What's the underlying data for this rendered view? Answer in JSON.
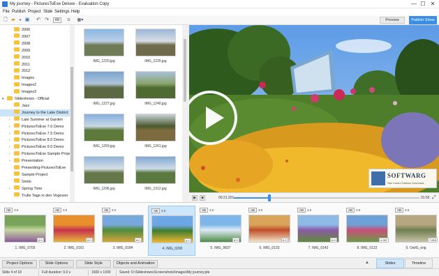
{
  "window": {
    "title": "My journey - PicturesToExe Deluxe - Evaluation Copy",
    "minimize": "—",
    "maximize": "☐",
    "close": "✕"
  },
  "menu": [
    "File",
    "Publish",
    "Project",
    "Slide",
    "Settings",
    "Help"
  ],
  "toolbar": {
    "ab_label": "AB",
    "drive_label": "D:",
    "preview_label": "Preview",
    "publish_label": "Publish Show"
  },
  "tree": {
    "items": [
      {
        "label": "2006",
        "indent": 1
      },
      {
        "label": "2007",
        "indent": 1
      },
      {
        "label": "2008",
        "indent": 1
      },
      {
        "label": "2009",
        "indent": 1
      },
      {
        "label": "2010",
        "indent": 1
      },
      {
        "label": "2011",
        "indent": 1
      },
      {
        "label": "2012",
        "indent": 1
      },
      {
        "label": "Images",
        "indent": 1
      },
      {
        "label": "Images2",
        "indent": 1
      },
      {
        "label": "Images3",
        "indent": 1
      },
      {
        "label": "Slideshows - Official",
        "indent": 0,
        "expanded": true
      },
      {
        "label": "Jazz",
        "indent": 1
      },
      {
        "label": "Journey to the Lake District",
        "indent": 1,
        "selected": true
      },
      {
        "label": "Late Summer at Garden",
        "indent": 1,
        "collapsed": true
      },
      {
        "label": "PicturesToExe 7.0 Demo",
        "indent": 1,
        "collapsed": true
      },
      {
        "label": "PicturesToExe 7.5 Demo",
        "indent": 1,
        "collapsed": true
      },
      {
        "label": "PicturesToExe 8.0 Demo",
        "indent": 1,
        "collapsed": true
      },
      {
        "label": "PicturesToExe 9.0 Demo",
        "indent": 1,
        "collapsed": true
      },
      {
        "label": "PicturesToExe Sample Project",
        "indent": 1,
        "collapsed": true
      },
      {
        "label": "Presentation",
        "indent": 1,
        "collapsed": true
      },
      {
        "label": "Presenting-PicturesToExe",
        "indent": 1
      },
      {
        "label": "Sample Project",
        "indent": 1
      },
      {
        "label": "Smile",
        "indent": 1
      },
      {
        "label": "Spring Time",
        "indent": 1,
        "collapsed": true
      },
      {
        "label": "Trulle Tage in den Vogesen",
        "indent": 1
      }
    ]
  },
  "files": [
    {
      "name": "IMG_1220.jpg",
      "colors": [
        "#8db6e0",
        "#b9cfe6",
        "#6f7b57"
      ]
    },
    {
      "name": "IMG_1225.jpg",
      "colors": [
        "#9ab8d6",
        "#d8dde3",
        "#6f6a4c"
      ]
    },
    {
      "name": "IMG_1227.jpg",
      "colors": [
        "#7aa3cf",
        "#b0c4d8",
        "#5c6841"
      ]
    },
    {
      "name": "IMG_1240.jpg",
      "colors": [
        "#a6c1dc",
        "#8aa36a",
        "#4f6b32"
      ]
    },
    {
      "name": "IMG_1259.jpg",
      "colors": [
        "#86b0dc",
        "#c9d8e6",
        "#5d7a3a"
      ]
    },
    {
      "name": "IMG_1261.jpg",
      "colors": [
        "#c9d2d9",
        "#4c5a30",
        "#7d6a3f"
      ]
    },
    {
      "name": "IMG_1296.jpg",
      "colors": [
        "#8fb4d9",
        "#d7dfe6",
        "#66784a"
      ]
    },
    {
      "name": "IMG_1312.jpg",
      "colors": [
        "#7fa8d2",
        "#cfdbe6",
        "#5c7942"
      ]
    }
  ],
  "player": {
    "time_current": "00:21.201",
    "time_total": "01:56",
    "progress": 0.19,
    "play": "▶",
    "stop": "■",
    "expand": "⤢"
  },
  "watermark": {
    "brand": "SOFTWARG",
    "tagline": "Safe Hosted Software Downloads"
  },
  "slides": [
    {
      "label": "1. IMG_0703",
      "ab": "AB",
      "duration": "3.0",
      "thumb_duration": "6.0",
      "colors": [
        "#79a35b",
        "#c6d7a1",
        "#8a5b9a"
      ]
    },
    {
      "label": "2. IMG_0161",
      "ab": "AB",
      "duration": "3.0",
      "thumb_duration": "6.0",
      "colors": [
        "#e88f2c",
        "#c8324d",
        "#e5b63b"
      ]
    },
    {
      "label": "3. IMG_0184",
      "ab": "AB",
      "duration": "3.0",
      "thumb_duration": "6.0",
      "colors": [
        "#78a9dc",
        "#4f8a3c",
        "#d5a53a"
      ]
    },
    {
      "label": "4. IMG_0200",
      "ab": "AB",
      "duration": "3.0",
      "thumb_duration": "6.0",
      "colors": [
        "#6ea7e6",
        "#3f7c2e",
        "#efb932"
      ],
      "selected": true
    },
    {
      "label": "5. IMG_9607",
      "ab": "AB",
      "duration": "3.0",
      "thumb_duration": "6.0",
      "colors": [
        "#7db7ea",
        "#dfeaf3",
        "#4e8b45"
      ]
    },
    {
      "label": "6. IMG_0133",
      "ab": "AB",
      "duration": "3.0",
      "thumb_duration": "6.0",
      "colors": [
        "#d9a55b",
        "#c14d2a",
        "#f1e3c6"
      ]
    },
    {
      "label": "7. IMG_0142",
      "ab": "AB",
      "duration": "3.0",
      "thumb_duration": "6.0",
      "colors": [
        "#8dbbe6",
        "#8c5aa6",
        "#5f8b3a"
      ]
    },
    {
      "label": "8. IMG_0122",
      "ab": "AB",
      "duration": "3.0",
      "thumb_duration": "4.987",
      "colors": [
        "#6ea2d6",
        "#c84f7a",
        "#6b9b46"
      ]
    },
    {
      "label": "9. OwlG_orig",
      "ab": "AB",
      "duration": "3.0",
      "thumb_duration": "7.653",
      "colors": [
        "#b7a680",
        "#6e7d4e",
        "#c9c2a8"
      ]
    }
  ],
  "bottom": {
    "project_options": "Project Options",
    "slide_options": "Slide Options",
    "slide_style": "Slide Style",
    "objects": "Objects and Animation",
    "up": "▲",
    "tab_slides": "Slides",
    "tab_timeline": "Timeline"
  },
  "status": {
    "slide": "Slide 4 of 18",
    "duration": "Full duration: 9.0 s",
    "resolution": "1500 x 1000",
    "saved": "Saved: D:\\Slideshows\\Screenshots\\Images\\My journey.pte"
  }
}
